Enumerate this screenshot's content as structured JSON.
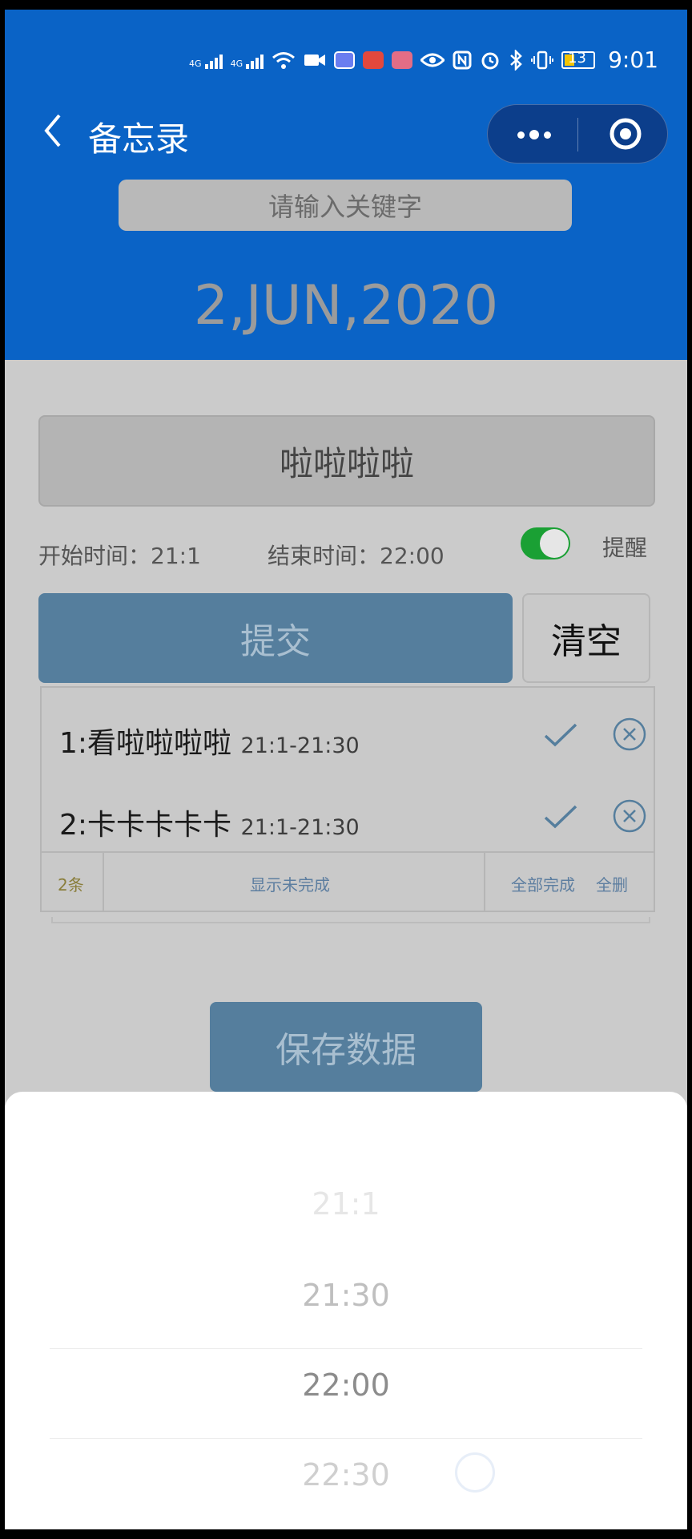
{
  "status_bar": {
    "network1": "4G",
    "network2": "4G",
    "battery": "13",
    "time": "9:01"
  },
  "nav": {
    "title": "备忘录"
  },
  "search": {
    "placeholder": "请输入关键字"
  },
  "date": "2,JUN,2020",
  "task_input": {
    "value": "啦啦啦啦"
  },
  "times": {
    "start_label": "开始时间：",
    "start_value": "21:1",
    "end_label": "结束时间：",
    "end_value": "22:00"
  },
  "reminder": {
    "label": "提醒",
    "enabled": true
  },
  "buttons": {
    "submit": "提交",
    "clear": "清空",
    "save": "保存数据"
  },
  "todos": [
    {
      "index": "1:",
      "text": "看啦啦啦啦",
      "range": "21:1-21:30"
    },
    {
      "index": "2:",
      "text": "卡卡卡卡卡",
      "range": "21:1-21:30"
    }
  ],
  "list_footer": {
    "count": "2条",
    "show_incomplete": "显示未完成",
    "complete_all": "全部完成",
    "delete_all": "全删"
  },
  "picker": {
    "options": [
      "21:1",
      "21:30",
      "22:00",
      "22:30"
    ],
    "selected": "22:00"
  },
  "colors": {
    "header": "#0a63c6",
    "primary_button": "#557e9d",
    "toggle_on": "#1aa034"
  }
}
